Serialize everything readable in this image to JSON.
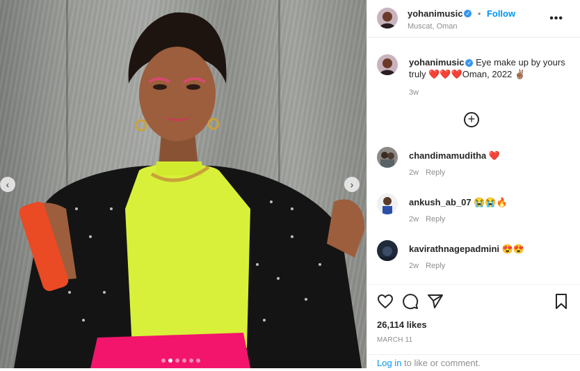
{
  "post": {
    "author": "yohanimusic",
    "location": "Muscat, Oman",
    "follow_label": "Follow",
    "separator": "•",
    "more_label": "•••",
    "caption": "Eye make up by yours truly ❤️❤️❤️Oman, 2022 ✌🏽",
    "caption_time": "3w",
    "likes": "26,114 likes",
    "date": "MARCH 11"
  },
  "comments": [
    {
      "user": "chandimamuditha",
      "text": "❤️",
      "time": "2w",
      "reply_label": "Reply"
    },
    {
      "user": "ankush_ab_07",
      "text": "😭😭🔥",
      "time": "2w",
      "reply_label": "Reply"
    },
    {
      "user": "kavirathnagepadmini",
      "text": "😍😍",
      "time": "2w",
      "reply_label": "Reply"
    }
  ],
  "login": {
    "link": "Log in",
    "rest": " to like or comment."
  },
  "carousel": {
    "prev": "‹",
    "next": "›",
    "slides": 6,
    "active": 1
  },
  "icons": [
    "heart-icon",
    "comment-icon",
    "share-icon",
    "bookmark-icon",
    "add-comment-icon",
    "verified-icon"
  ],
  "colors": {
    "link": "#0095f6",
    "verified": "#3897f0",
    "text": "#262626",
    "muted": "#8e8e8e"
  }
}
